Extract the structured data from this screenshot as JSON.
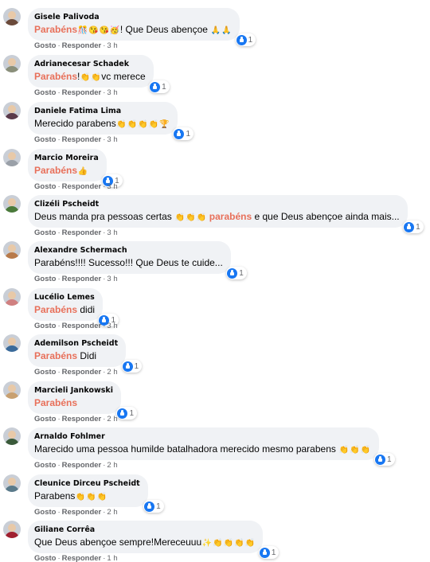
{
  "actions": {
    "like_label": "Gosto",
    "reply_label": "Responder",
    "separator": "·"
  },
  "colors": {
    "bubble": "#f0f2f5",
    "highlight": "#e8705a",
    "like_blue": "#1877f2",
    "muted": "#65676b"
  },
  "comments": [
    {
      "author": "Gisele Palivoda",
      "time": "3 h",
      "reaction_count": "1",
      "avatar_color": "#6b4a3a",
      "segments": [
        {
          "t": "Parabéns",
          "hl": true
        },
        {
          "e": "🎊"
        },
        {
          "e": "😘"
        },
        {
          "e": "😘"
        },
        {
          "e": "🥳"
        },
        {
          "t": "! Que Deus abençoe "
        },
        {
          "e": "🙏"
        },
        {
          "e": "🙏"
        }
      ]
    },
    {
      "author": "Adrianecesar Schadek",
      "time": "3 h",
      "reaction_count": "1",
      "avatar_color": "#8a8f7a",
      "segments": [
        {
          "t": "Parabéns",
          "hl": true
        },
        {
          "t": "!"
        },
        {
          "e": "👏"
        },
        {
          "e": "👏"
        },
        {
          "t": "vc merece"
        }
      ]
    },
    {
      "author": "Daniele Fatima Lima",
      "time": "3 h",
      "reaction_count": "1",
      "avatar_color": "#5a3a4a",
      "segments": [
        {
          "t": "Merecido parabens"
        },
        {
          "e": "👏"
        },
        {
          "e": "👏"
        },
        {
          "e": "👏"
        },
        {
          "e": "👏"
        },
        {
          "e": "🏆"
        }
      ]
    },
    {
      "author": "Marcio Moreira",
      "time": "3 h",
      "reaction_count": "1",
      "avatar_color": "#9aa0a8",
      "segments": [
        {
          "t": "Parabéns",
          "hl": true
        },
        {
          "e": "👍"
        }
      ]
    },
    {
      "author": "Clizéli Pscheidt",
      "time": "3 h",
      "reaction_count": "1",
      "avatar_color": "#4a7a3a",
      "segments": [
        {
          "t": "Deus manda pra pessoas certas "
        },
        {
          "e": "👏"
        },
        {
          "e": "👏"
        },
        {
          "e": "👏"
        },
        {
          "t": " "
        },
        {
          "t": "parabéns",
          "hl": true
        },
        {
          "t": " e que Deus abençoe ainda mais..."
        }
      ]
    },
    {
      "author": "Alexandre Schermach",
      "time": "3 h",
      "reaction_count": "1",
      "avatar_color": "#b87a4a",
      "segments": [
        {
          "t": "Parabéns!!!! Sucesso!!! Que Deus te cuide..."
        }
      ]
    },
    {
      "author": "Lucélio Lemes",
      "time": "3 h",
      "reaction_count": "1",
      "avatar_color": "#d08080",
      "segments": [
        {
          "t": "Parabéns",
          "hl": true
        },
        {
          "t": " didi"
        }
      ]
    },
    {
      "author": "Ademilson Pscheidt",
      "time": "2 h",
      "reaction_count": "1",
      "avatar_color": "#3a6a9a",
      "segments": [
        {
          "t": "Parabéns",
          "hl": true
        },
        {
          "t": " Didi"
        }
      ]
    },
    {
      "author": "Marcieli Jankowski",
      "time": "2 h",
      "reaction_count": "1",
      "avatar_color": "#c8a070",
      "segments": [
        {
          "t": "Parabéns",
          "hl": true
        }
      ]
    },
    {
      "author": "Arnaldo Fohlmer",
      "time": "2 h",
      "reaction_count": "1",
      "avatar_color": "#3a5a3a",
      "segments": [
        {
          "t": "Marecido uma pessoa humilde batalhadora merecido mesmo parabens "
        },
        {
          "e": "👏"
        },
        {
          "e": "👏"
        },
        {
          "e": "👏"
        }
      ]
    },
    {
      "author": "Cleunice Dirceu Pscheidt",
      "time": "2 h",
      "reaction_count": "1",
      "avatar_color": "#5a7a8a",
      "segments": [
        {
          "t": "Parabens"
        },
        {
          "e": "👏"
        },
        {
          "e": "👏"
        },
        {
          "e": "👏"
        }
      ]
    },
    {
      "author": "Giliane Corrêa",
      "time": "1 h",
      "reaction_count": "1",
      "avatar_color": "#a02030",
      "segments": [
        {
          "t": "Que Deus abençoe sempre!Mereceuuu"
        },
        {
          "e": "✨"
        },
        {
          "e": "👏"
        },
        {
          "e": "👏"
        },
        {
          "e": "👏"
        },
        {
          "e": "👏"
        }
      ]
    }
  ]
}
